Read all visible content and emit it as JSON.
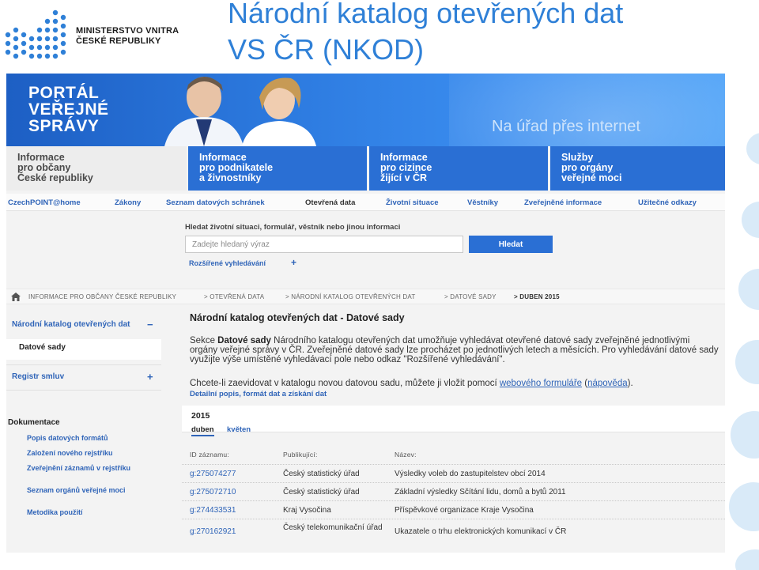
{
  "slide": {
    "ministry_line1": "MINISTERSTVO VNITRA",
    "ministry_line2": "ČESKÉ REPUBLIKY",
    "title_line1": "Národní katalog otevřených dat",
    "title_line2": "VS ČR (NKOD)"
  },
  "banner": {
    "portal_line1": "PORTÁL",
    "portal_line2": "VEŘEJNÉ",
    "portal_line3": "SPRÁVY",
    "tagline": "Na úřad přes internet"
  },
  "categories": [
    {
      "line1": "Informace",
      "line2": "pro občany",
      "line3": "České republiky"
    },
    {
      "line1": "Informace",
      "line2": "pro podnikatele",
      "line3": "a živnostníky"
    },
    {
      "line1": "Informace",
      "line2": "pro cizince",
      "line3": "žijící v ČR"
    },
    {
      "line1": "Služby",
      "line2": "pro orgány",
      "line3": "veřejné moci"
    }
  ],
  "nav": [
    "CzechPOINT@home",
    "Zákony",
    "Seznam datových schránek",
    "Otevřená data",
    "Životní situace",
    "Věstníky",
    "Zveřejněné informace",
    "Užitečné odkazy"
  ],
  "search": {
    "label": "Hledat životní situaci, formulář, věstník nebo jinou informaci",
    "placeholder": "Zadejte hledaný výraz",
    "button": "Hledat",
    "advanced": "Rozšířené vyhledávání",
    "advanced_plus": "+"
  },
  "breadcrumb": [
    "INFORMACE PRO OBČANY ČESKÉ REPUBLIKY",
    "> OTEVŘENÁ DATA",
    "> NÁRODNÍ KATALOG OTEVŘENÝCH DAT",
    "> DATOVÉ SADY",
    "> DUBEN 2015"
  ],
  "sidebar": {
    "catalog": "Národní katalog otevřených dat",
    "minus": "−",
    "datasets": "Datové sady",
    "registr": "Registr smluv",
    "plus": "+",
    "doc_heading": "Dokumentace",
    "doc_links": [
      "Popis datových formátů",
      "Založení nového rejstříku",
      "Zveřejnění záznamů v rejstříku",
      "Seznam orgánů veřejné moci",
      "Metodika použití"
    ]
  },
  "main": {
    "title": "Národní katalog otevřených dat - Datové sady",
    "para_prefix": "Sekce ",
    "para_bold": "Datové sady",
    "para_rest": " Národního katalogu otevřených dat umožňuje vyhledávat otevřené datové sady zveřejněné jednotlivými orgány veřejné správy v ČR. Zveřejněné datové sady lze procházet po jednotlivých letech a měsících. Pro vyhledávání datové sady využijte výše umístěné vyhledávací pole nebo odkaz \"Rozšířené vyhledávání\".",
    "para2_prefix": "Chcete-li zaevidovat v katalogu novou datovou sadu, můžete ji vložit pomocí ",
    "para2_link1": "webového formuláře",
    "para2_mid": " (",
    "para2_link2": "nápověda",
    "para2_suffix": ").",
    "detail_link": "Detailní popis, formát dat a získání dat",
    "year": "2015",
    "month_active": "duben",
    "month_link": "květen",
    "table_headers": [
      "ID záznamu:",
      "Publikující:",
      "Název:"
    ],
    "rows": [
      {
        "id": "g:275074277",
        "publisher": "Český statistický úřad",
        "name": "Výsledky voleb do zastupitelstev obcí 2014"
      },
      {
        "id": "g:275072710",
        "publisher": "Český statistický úřad",
        "name": "Základní výsledky Sčítání lidu, domů a bytů 2011"
      },
      {
        "id": "g:274433531",
        "publisher": "Kraj Vysočina",
        "name": "Příspěvkové organizace Kraje Vysočina"
      },
      {
        "id": "g:270162921",
        "publisher": "Český telekomunikační úřad",
        "name": "Ukazatele o trhu elektronických komunikací v ČR"
      }
    ]
  },
  "colors": {
    "title_blue": "#2f80d7",
    "accent_blue": "#2a6fd4",
    "link_blue": "#2f64b8"
  }
}
